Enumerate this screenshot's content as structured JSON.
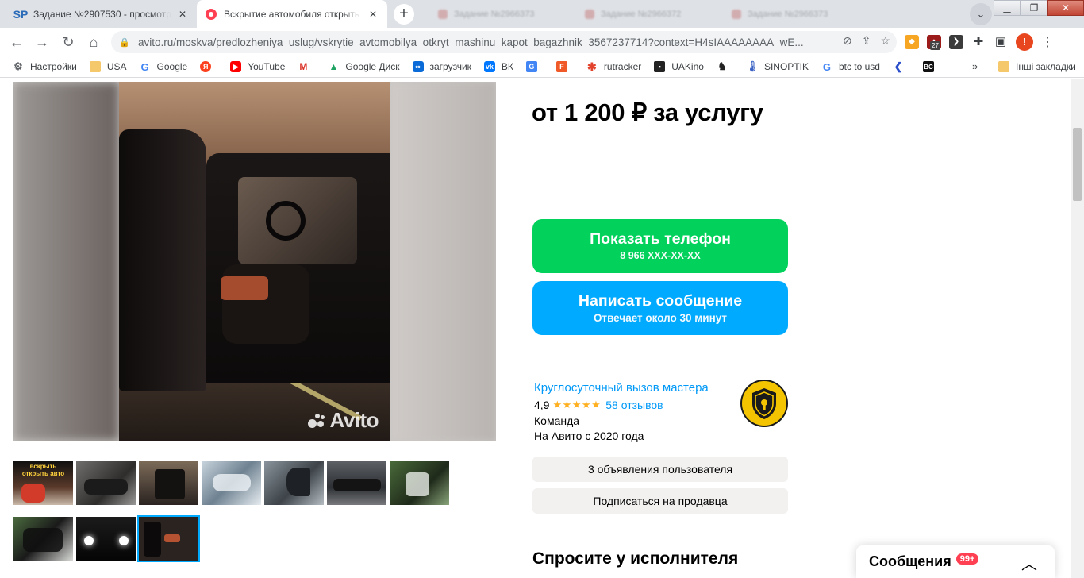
{
  "browser": {
    "tabs": [
      {
        "title": "Задание №2907530 - просмотр",
        "favicon": "SP"
      },
      {
        "title": "Вскрытие автомобиля открыть машину",
        "favicon": "avito-icon"
      }
    ],
    "ghost_tabs": [
      "Задание №2966373",
      "Задание №2966372",
      "Задание №2966373"
    ],
    "url": "avito.ru/moskva/predlozheniya_uslug/vskrytie_avtomobilya_otkryt_mashinu_kapot_bagazhnik_3567237714?context=H4sIAAAAAAAA_wE...",
    "extension_badge": "27",
    "profile_initial": "!",
    "bookmarks": [
      {
        "label": "Настройки",
        "icon": "gear-icon"
      },
      {
        "label": "USA",
        "icon": "folder-icon"
      },
      {
        "label": "Google",
        "icon": "google-icon"
      },
      {
        "label": "",
        "icon": "yandex-icon"
      },
      {
        "label": "YouTube",
        "icon": "youtube-icon"
      },
      {
        "label": "",
        "icon": "gmail-icon"
      },
      {
        "label": "Google Диск",
        "icon": "drive-icon"
      },
      {
        "label": "загрузчик",
        "icon": "loader-icon"
      },
      {
        "label": "ВК",
        "icon": "vk-icon"
      },
      {
        "label": "",
        "icon": "translate-icon"
      },
      {
        "label": "",
        "icon": "f-icon"
      },
      {
        "label": "rutracker",
        "icon": "rutracker-icon"
      },
      {
        "label": "UAKino",
        "icon": "uakino-icon"
      },
      {
        "label": "",
        "icon": "pawn-icon"
      },
      {
        "label": "SINOPTIK",
        "icon": "thermometer-icon"
      },
      {
        "label": "btc to usd",
        "icon": "google-icon"
      },
      {
        "label": "",
        "icon": "arrow-icon"
      },
      {
        "label": "",
        "icon": "bc-icon"
      }
    ],
    "bookmarks_more": "»",
    "other_bookmarks": "Інші закладки"
  },
  "listing": {
    "price": "от 1 200 ₽ за услугу",
    "phone_button": {
      "label": "Показать телефон",
      "sub": "8 966 XXX-XX-XX"
    },
    "message_button": {
      "label": "Написать сообщение",
      "sub": "Отвечает около 30 минут"
    },
    "seller": {
      "name": "Круглосуточный вызов мастера",
      "rating": "4,9",
      "stars": "★★★★★",
      "reviews": "58 отзывов",
      "type": "Команда",
      "since": "На Авито с 2020 года"
    },
    "seller_ads_button": "3 объявления пользователя",
    "subscribe_button": "Подписаться на продавца",
    "ask_title": "Спросите у исполнителя",
    "watermark": "Avito",
    "thumbnail_count": 10,
    "selected_thumbnail": 10,
    "thumb1_text": "вскрыть открыть авто"
  },
  "messenger": {
    "label": "Сообщения",
    "badge": "99+"
  },
  "colors": {
    "green": "#02d15c",
    "blue": "#00aaff",
    "link": "#0099f7",
    "star": "#ffb021"
  }
}
